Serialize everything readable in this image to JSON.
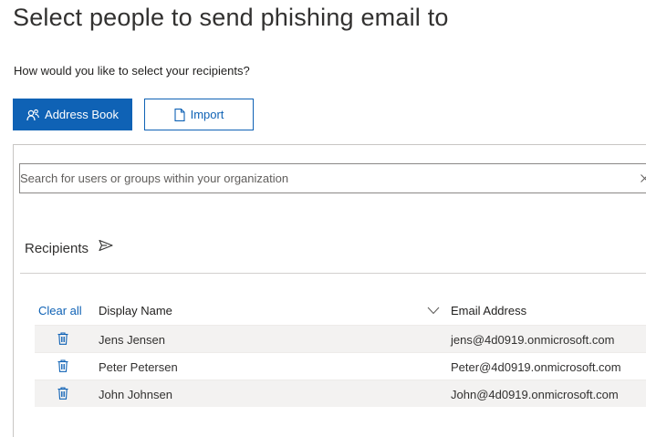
{
  "page": {
    "title": "Select people to send phishing email to",
    "question": "How would you like to select your recipients?"
  },
  "buttons": {
    "address_book_label": "Address Book",
    "address_book_icon": "contacts-icon",
    "import_label": "Import",
    "import_icon": "document-icon"
  },
  "search": {
    "placeholder": "Search for users or groups within your organization",
    "value": "",
    "clear_icon": "close-icon"
  },
  "recipients": {
    "label": "Recipients",
    "icon": "send-icon",
    "clear_all_label": "Clear all",
    "columns": {
      "display_name": "Display Name",
      "email_address": "Email Address"
    },
    "rows": [
      {
        "display_name": "Jens Jensen",
        "email": "jens@4d0919.onmicrosoft.com"
      },
      {
        "display_name": "Peter Petersen",
        "email": "Peter@4d0919.onmicrosoft.com"
      },
      {
        "display_name": "John Johnsen",
        "email": "John@4d0919.onmicrosoft.com"
      }
    ]
  },
  "colors": {
    "accent": "#0f62b5",
    "row_shade": "#f3f2f1",
    "text": "#323130"
  }
}
